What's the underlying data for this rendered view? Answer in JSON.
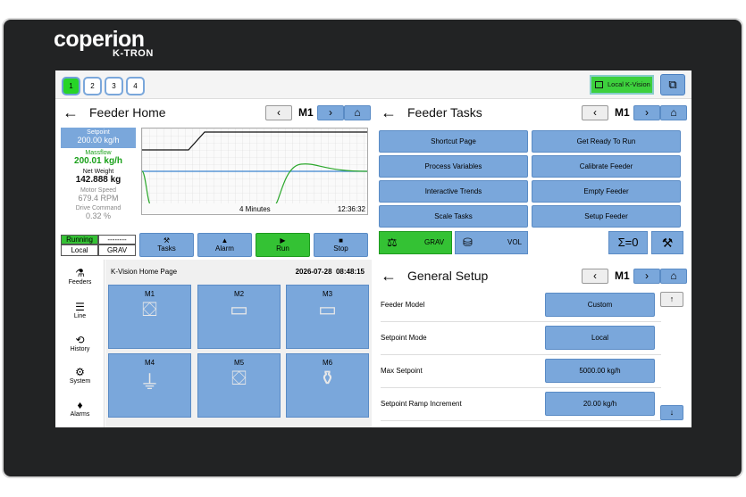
{
  "brand": {
    "line1": "coperion",
    "line2": "K-TRON"
  },
  "channels": [
    "1",
    "2",
    "3",
    "4"
  ],
  "topbar": {
    "kvision_label": "Local K-Vision"
  },
  "feeder_home": {
    "title": "Feeder Home",
    "feeder": "M1",
    "setpoint_label": "Setpoint",
    "setpoint_value": "200.00 kg/h",
    "massflow_label": "Massflow",
    "massflow_value": "200.01 kg/h",
    "netweight_label": "Net Weight",
    "netweight_value": "142.888 kg",
    "motorspeed_label": "Motor Speed",
    "motorspeed_value": "679.4 RPM",
    "drive_label": "Drive Command",
    "drive_value": "0.32 %",
    "status_running": "Running",
    "status_dashes": "--------",
    "status_local": "Local",
    "status_grav": "GRAV",
    "trend_span": "4 Minutes",
    "trend_time": "12:36:32",
    "buttons": {
      "tasks": "Tasks",
      "alarm": "Alarm",
      "run": "Run",
      "stop": "Stop"
    }
  },
  "sidenav": {
    "feeders": "Feeders",
    "line": "Line",
    "history": "History",
    "system": "System",
    "alarms": "Alarms"
  },
  "kvision": {
    "title": "K-Vision Home Page",
    "date": "2026-07-28",
    "time": "08:48:15",
    "tiles": [
      "M1",
      "M2",
      "M3",
      "M4",
      "M5",
      "M6"
    ]
  },
  "feeder_tasks": {
    "title": "Feeder Tasks",
    "feeder": "M1",
    "items": [
      "Shortcut Page",
      "Get Ready To Run",
      "Process Variables",
      "Calibrate Feeder",
      "Interactive Trends",
      "Empty Feeder",
      "Scale Tasks",
      "Setup Feeder"
    ],
    "mode_grav": "GRAV",
    "mode_vol": "VOL",
    "zero_label": "Σ=0"
  },
  "general_setup": {
    "title": "General Setup",
    "feeder": "M1",
    "rows": [
      {
        "label": "Feeder Model",
        "value": "Custom"
      },
      {
        "label": "Setpoint Mode",
        "value": "Local"
      },
      {
        "label": "Max Setpoint",
        "value": "5000.00 kg/h"
      },
      {
        "label": "Setpoint Ramp Increment",
        "value": "20.00 kg/h"
      }
    ]
  },
  "colors": {
    "accent": "#7aa7db",
    "run_green": "#34c234",
    "massflow_green": "#19a019",
    "bezel": "#222324"
  }
}
